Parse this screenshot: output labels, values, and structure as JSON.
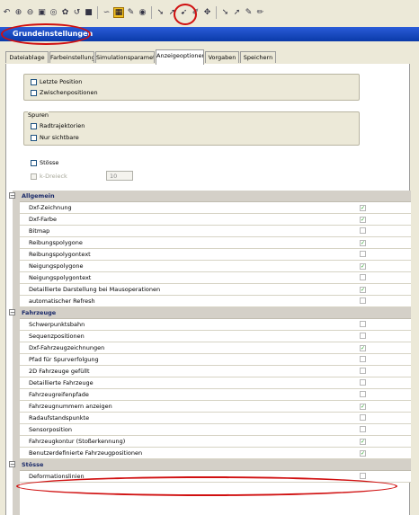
{
  "toolbar": {
    "icons": [
      "back-icon",
      "zoom-in-icon",
      "zoom-out-icon",
      "zoom-window-icon",
      "zoom-all-icon",
      "gear-icon",
      "undo-icon",
      "color-icon",
      "lasso-icon",
      "settings-icon",
      "pen-icon",
      "eye-icon",
      "arrow-icon",
      "cursor-icon",
      "pointer-icon",
      "brush-icon",
      "move-icon",
      "select-icon",
      "cursor2-icon",
      "brush2-icon",
      "pencil-icon"
    ],
    "highlighted_index": 9
  },
  "window": {
    "title": "Grundeinstellungen"
  },
  "tabs": [
    {
      "label": "Dateiablage"
    },
    {
      "label": "Farbeinstellung"
    },
    {
      "label": "Simulationsparameter"
    },
    {
      "label": "Anzeigeoptionen",
      "active": true
    },
    {
      "label": "Vorgaben"
    },
    {
      "label": "Speichern"
    }
  ],
  "position_group": {
    "items": [
      {
        "label": "Letzte Position",
        "checked": false
      },
      {
        "label": "Zwischenpositionen",
        "checked": false
      }
    ]
  },
  "spuren_group": {
    "title": "Spuren",
    "items": [
      {
        "label": "Radtrajektorien",
        "checked": false
      },
      {
        "label": "Nur sichtbare",
        "checked": false
      }
    ]
  },
  "stoesse": {
    "label": "Stösse",
    "checked": false
  },
  "dreieck": {
    "label": "k-Dreieck",
    "value": "10",
    "disabled": true
  },
  "property_grid": [
    {
      "category": "Allgemein",
      "rows": [
        {
          "name": "Dxf-Zeichnung",
          "checked": true
        },
        {
          "name": "Dxf-Farbe",
          "checked": true
        },
        {
          "name": "Bitmap",
          "checked": false
        },
        {
          "name": "Reibungspolygone",
          "checked": true
        },
        {
          "name": "Reibungspolygontext",
          "checked": false
        },
        {
          "name": "Neigungspolygone",
          "checked": true
        },
        {
          "name": "Neigungspolygontext",
          "checked": false
        },
        {
          "name": "Detaillierte Darstellung bei Mausoperationen",
          "checked": true
        },
        {
          "name": "automatischer Refresh",
          "checked": false
        }
      ]
    },
    {
      "category": "Fahrzeuge",
      "rows": [
        {
          "name": "Schwerpunktsbahn",
          "checked": false
        },
        {
          "name": "Sequenzpositionen",
          "checked": false
        },
        {
          "name": "Dxf-Fahrzeugzeichnungen",
          "checked": true
        },
        {
          "name": "Pfad für Spurverfolgung",
          "checked": false
        },
        {
          "name": "2D Fahrzeuge gefüllt",
          "checked": false
        },
        {
          "name": "Detaillierte Fahrzeuge",
          "checked": false
        },
        {
          "name": "Fahrzeugreifenpfade",
          "checked": false
        },
        {
          "name": "Fahrzeugnummern anzeigen",
          "checked": true
        },
        {
          "name": "Radaufstandspunkte",
          "checked": false
        },
        {
          "name": "Sensorposition",
          "checked": false
        },
        {
          "name": "Fahrzeugkontur (Stoßerkennung)",
          "checked": true
        },
        {
          "name": "Benutzerdefinierte Fahrzeugpositionen",
          "checked": true
        }
      ]
    },
    {
      "category": "Stösse",
      "rows": [
        {
          "name": "Deformationslinien",
          "checked": false
        }
      ]
    }
  ]
}
